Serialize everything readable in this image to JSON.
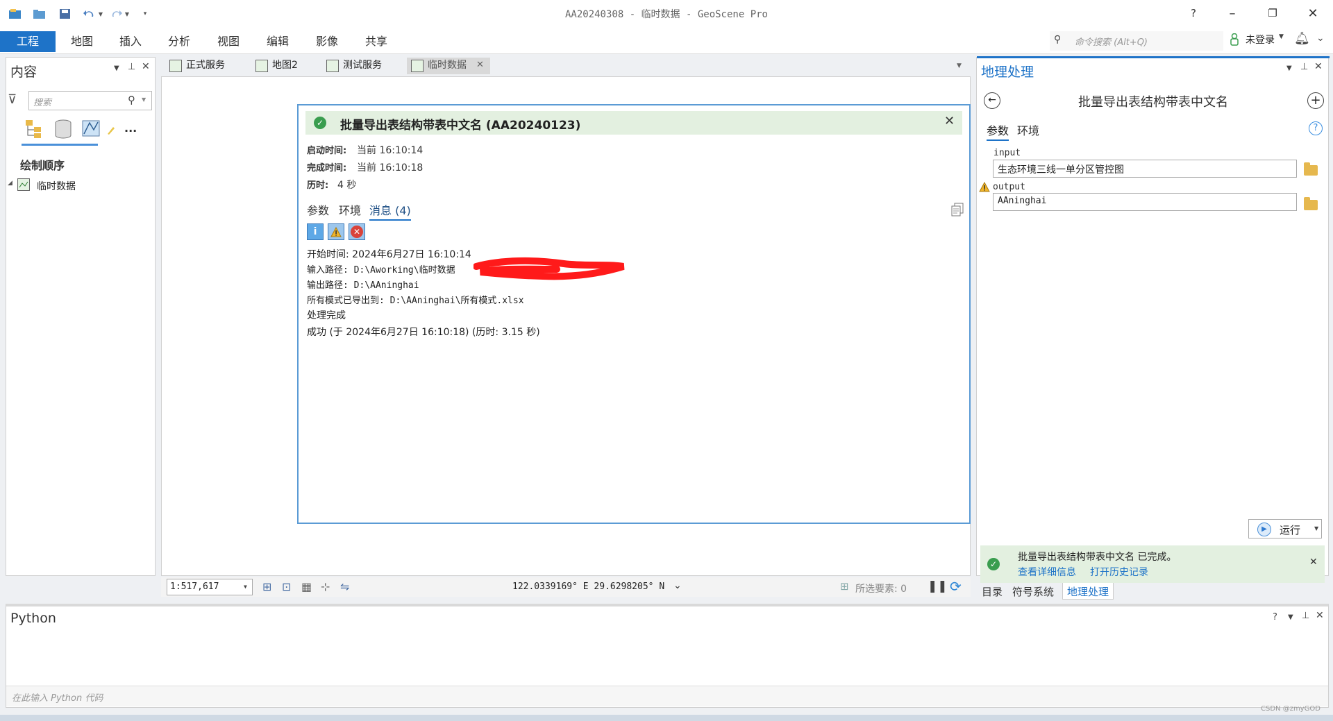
{
  "titlebar": {
    "title": "AA20240308 - 临时数据 - GeoScene Pro",
    "help": "?",
    "minimize": "–",
    "restore": "❐",
    "close": "✕"
  },
  "ribbon": {
    "tabs": [
      "工程",
      "地图",
      "插入",
      "分析",
      "视图",
      "编辑",
      "影像",
      "共享"
    ],
    "search_placeholder": "命令搜索 (Alt+Q)",
    "user_label": "未登录",
    "accent": "#1e73c8"
  },
  "contents": {
    "title": "内容",
    "search_placeholder": "搜索",
    "drawing_order": "绘制顺序",
    "layer": "临时数据",
    "more": "..."
  },
  "map_tabs": [
    "正式服务",
    "地图2",
    "测试服务",
    "临时数据"
  ],
  "dialog": {
    "title": "批量导出表结构带表中文名 (AA20240123)",
    "start_label": "启动时间:",
    "start_value": "当前 16:10:14",
    "end_label": "完成时间:",
    "end_value": "当前 16:10:18",
    "elapsed_label": "历时:",
    "elapsed_value": "4 秒",
    "tabs": [
      "参数",
      "环境",
      "消息 (4)"
    ],
    "messages": [
      "开始时间: 2024年6月27日 16:10:14",
      "输入路径: D:\\Aworking\\临时数据",
      "输出路径: D:\\AAninghai",
      "所有模式已导出到: D:\\AAninghai\\所有模式.xlsx",
      "处理完成",
      "成功 (于 2024年6月27日 16:10:18) (历时: 3.15 秒)"
    ]
  },
  "statusbar": {
    "scale": "1:517,617",
    "coords": "122.0339169° E 29.6298205° N",
    "selected": "所选要素: 0"
  },
  "geoprocessing": {
    "title": "地理处理",
    "tool_name": "批量导出表结构带表中文名",
    "tabs": [
      "参数",
      "环境"
    ],
    "input_label": "input",
    "input_value": "生态环境三线一单分区管控图",
    "output_label": "output",
    "output_value": "AAninghai",
    "run_label": "运行",
    "status": "批量导出表结构带表中文名 已完成。",
    "view_details": "查看详细信息",
    "open_history": "打开历史记录",
    "bottom_tabs": [
      "目录",
      "符号系统",
      "地理处理"
    ]
  },
  "python": {
    "title": "Python",
    "placeholder": "在此输入 Python 代码"
  },
  "watermark": "CSDN @zmyGOD"
}
